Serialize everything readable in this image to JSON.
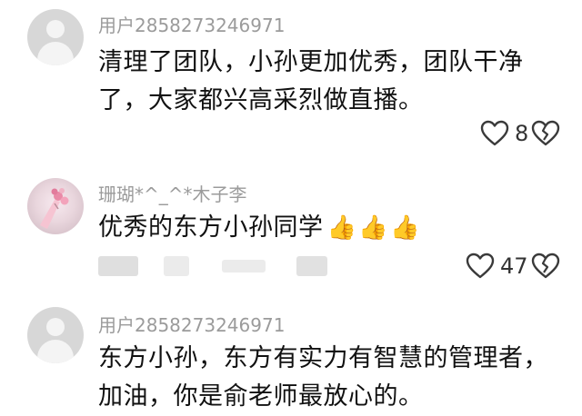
{
  "comments": [
    {
      "username": "用户2858273246971",
      "line1": "清理了团队，小孙更加优秀，团队干净",
      "line2": "了，大家都兴高采烈做直播。",
      "likes": "8"
    },
    {
      "username": "珊瑚*^_^*木子李",
      "text": "优秀的东方小孙同学",
      "emoji": [
        "👍",
        "👍",
        "👍"
      ],
      "likes": "47"
    },
    {
      "username": "用户2858273246971",
      "line1": "东方小孙，东方有实力有智慧的管理者，",
      "line2": "加油，你是俞老师最放心的。"
    }
  ],
  "icons": {
    "like": "heart-outline-icon",
    "dislike": "broken-heart-outline-icon",
    "default_avatar": "user-silhouette-icon"
  },
  "colors": {
    "username": "#9b9b9b",
    "text": "#111111",
    "avatar_default": "#d7d7d7"
  }
}
